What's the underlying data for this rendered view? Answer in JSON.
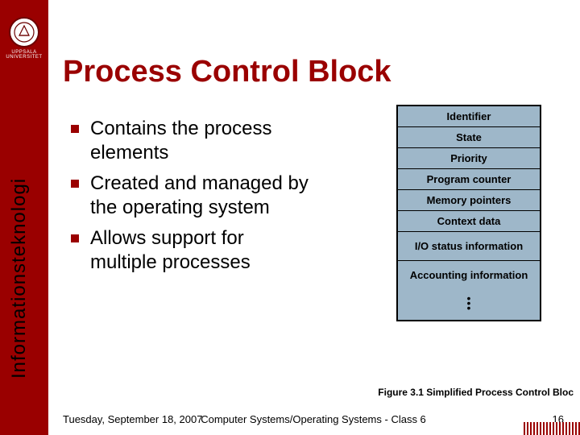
{
  "sidebar": {
    "university": "UPPSALA UNIVERSITET",
    "vertical_label": "Informationsteknologi"
  },
  "title": "Process Control Block",
  "bullets": [
    "Contains the process elements",
    "Created and managed by the operating system",
    "Allows support for multiple processes"
  ],
  "figure": {
    "cells": [
      "Identifier",
      "State",
      "Priority",
      "Program counter",
      "Memory pointers",
      "Context data",
      "I/O status information",
      "Accounting information"
    ],
    "caption": "Figure 3.1   Simplified Process Control Bloc"
  },
  "footer": {
    "date": "Tuesday, September 18, 2007",
    "center": "Computer Systems/Operating Systems - Class 6",
    "page": "16"
  }
}
